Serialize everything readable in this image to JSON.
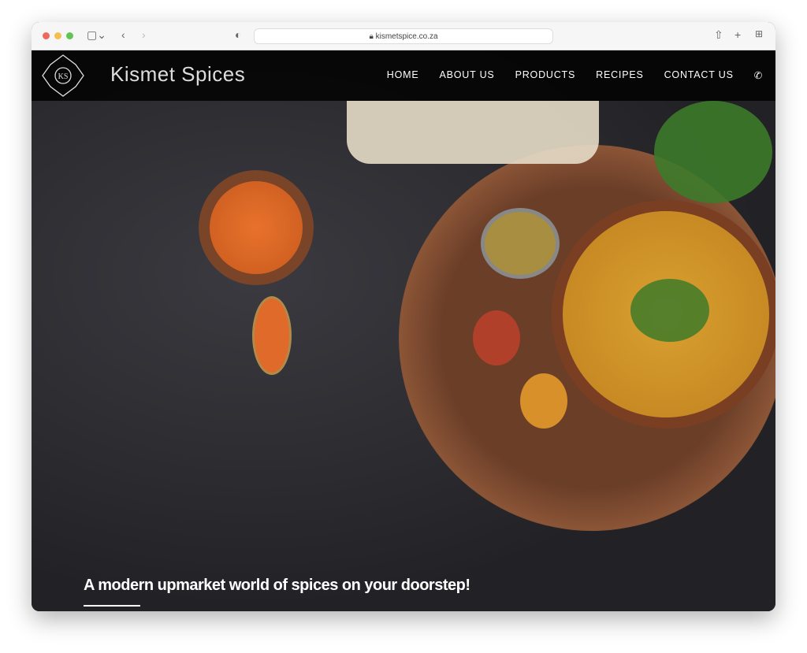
{
  "browser": {
    "url": "kismetspice.co.za"
  },
  "nav": {
    "brand": "Kismet Spices",
    "logo_text": "KS",
    "items": [
      "HOME",
      "ABOUT US",
      "PRODUCTS",
      "RECIPES",
      "CONTACT US"
    ],
    "phone_icon": "phone-icon"
  },
  "hero": {
    "tagline": "A modern upmarket world of spices on your doorstep!"
  },
  "colors": {
    "nav_bg": "#000000",
    "text": "#ffffff"
  }
}
